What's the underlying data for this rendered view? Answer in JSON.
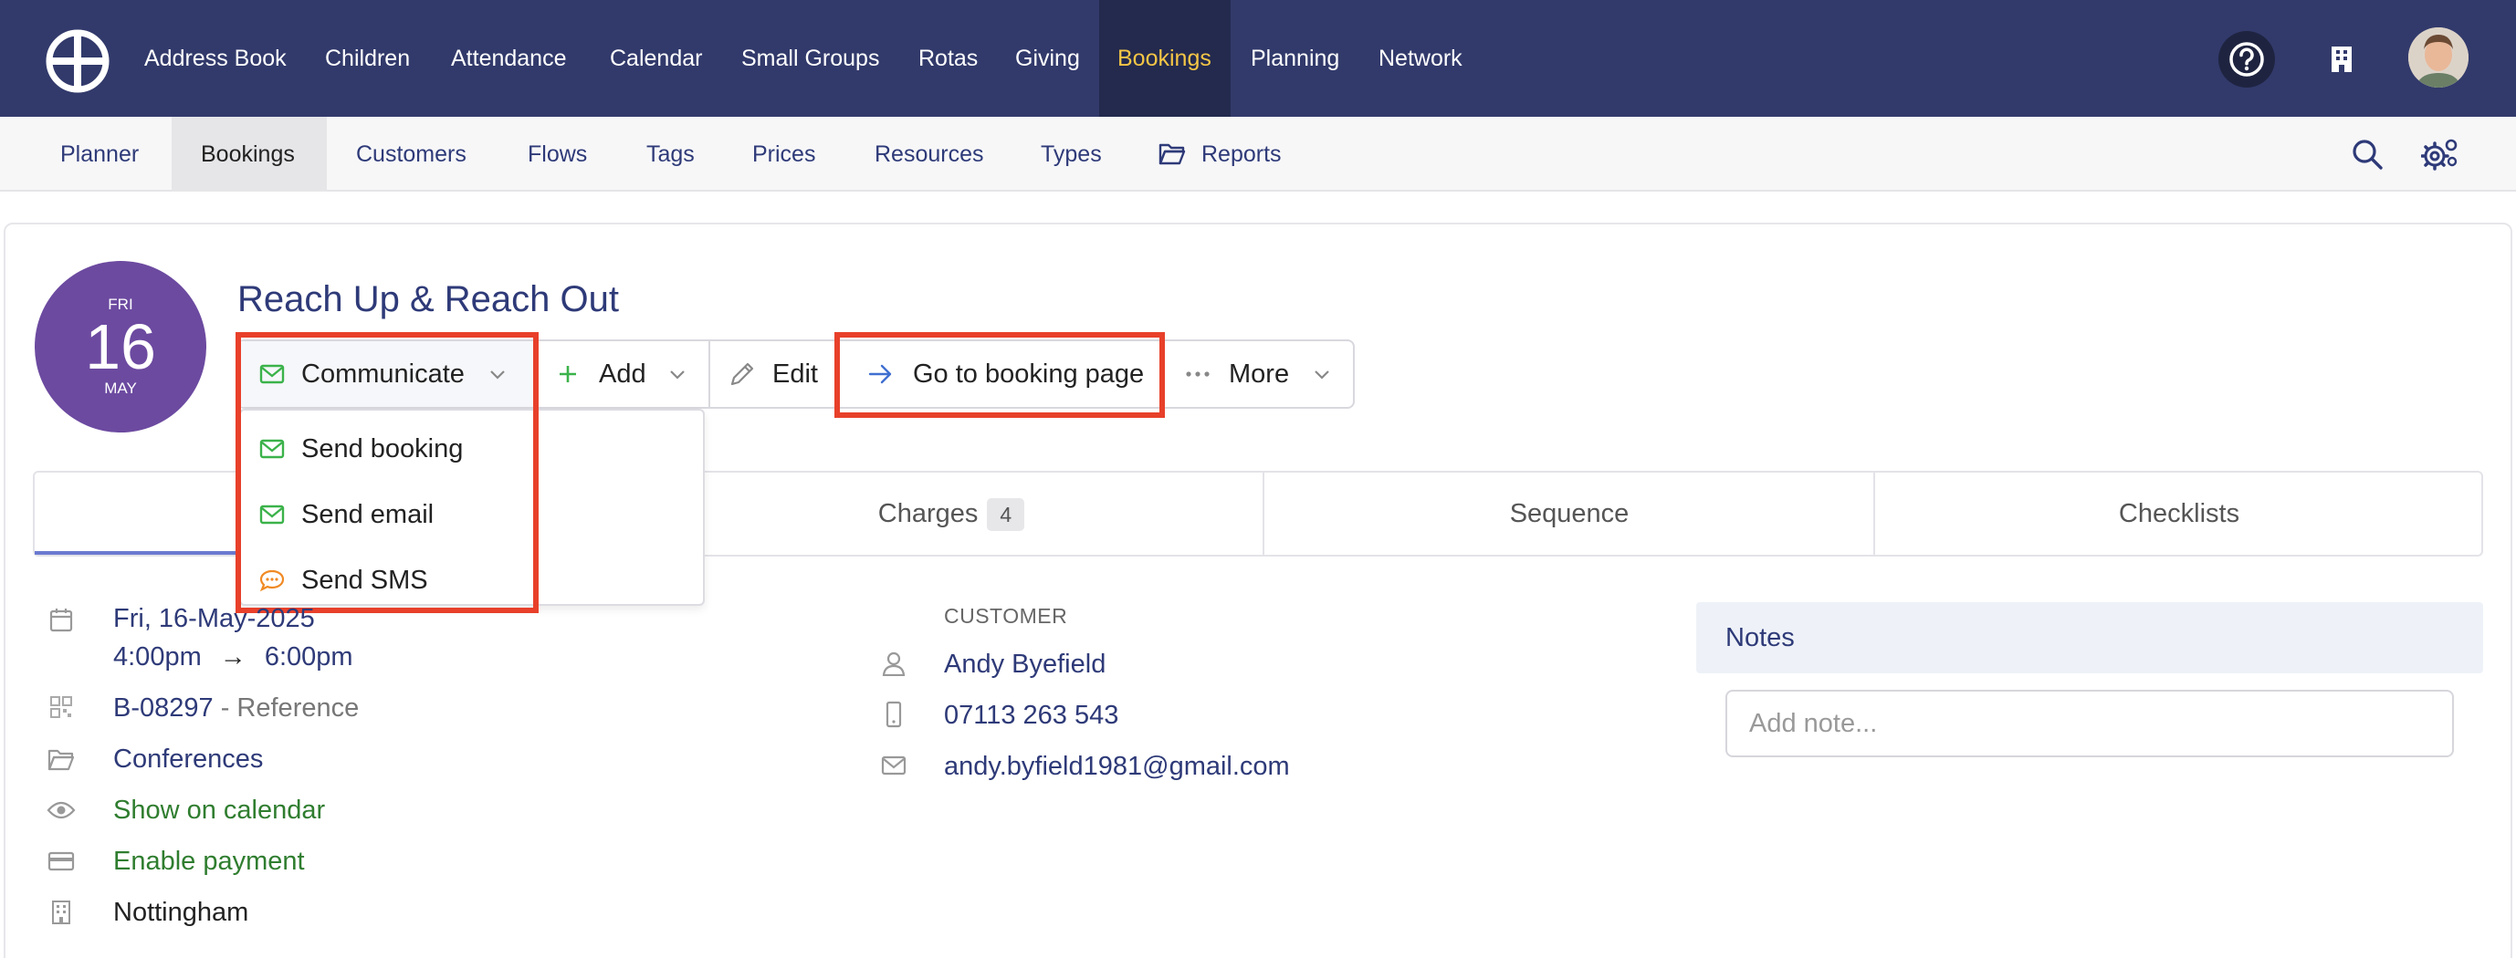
{
  "topnav": {
    "items": [
      {
        "label": "Address Book"
      },
      {
        "label": "Children"
      },
      {
        "label": "Attendance"
      },
      {
        "label": "Calendar"
      },
      {
        "label": "Small Groups"
      },
      {
        "label": "Rotas"
      },
      {
        "label": "Giving"
      },
      {
        "label": "Bookings",
        "active": true
      },
      {
        "label": "Planning"
      },
      {
        "label": "Network"
      }
    ],
    "icons": [
      "logo-icon",
      "help-icon",
      "building-icon",
      "avatar"
    ]
  },
  "subnav": {
    "items": [
      {
        "label": "Planner"
      },
      {
        "label": "Bookings",
        "active": true
      },
      {
        "label": "Customers"
      },
      {
        "label": "Flows"
      },
      {
        "label": "Tags"
      },
      {
        "label": "Prices"
      },
      {
        "label": "Resources"
      },
      {
        "label": "Types"
      },
      {
        "label": "Reports"
      }
    ],
    "icons": [
      "folder-icon",
      "search-icon",
      "settings-icon"
    ]
  },
  "booking": {
    "date": {
      "dow": "FRI",
      "day": "16",
      "month": "MAY"
    },
    "title": "Reach Up & Reach Out"
  },
  "toolbar": {
    "communicate": "Communicate",
    "add": "Add",
    "edit": "Edit",
    "goto": "Go to booking page",
    "more": "More"
  },
  "dropdown": {
    "items": [
      {
        "label": "Send booking",
        "icon": "mail-icon"
      },
      {
        "label": "Send email",
        "icon": "mail-icon"
      },
      {
        "label": "Send SMS",
        "icon": "chat-icon"
      }
    ]
  },
  "tabs": {
    "charges": "Charges",
    "charges_count": "4",
    "sequence": "Sequence",
    "checklists": "Checklists"
  },
  "details": {
    "date_line": "Fri, 16-May-2025",
    "time_start": "4:00pm",
    "time_arrow": "→",
    "time_end": "6:00pm",
    "reference_code": "B-08297",
    "reference_label": "- Reference",
    "category": "Conferences",
    "show_calendar": "Show on calendar",
    "enable_payment": "Enable payment",
    "location": "Nottingham"
  },
  "customer": {
    "heading": "CUSTOMER",
    "name": "Andy Byefield",
    "phone": "07113 263 543",
    "email": "andy.byfield1981@gmail.com"
  },
  "notes": {
    "title": "Notes",
    "placeholder": "Add note..."
  },
  "colors": {
    "nav_bg": "#323a6b",
    "nav_active_text": "#f5c646",
    "link": "#2e3a78",
    "badge": "#6c4aa0",
    "highlight": "#e8402a",
    "green": "#2f7d2f"
  }
}
